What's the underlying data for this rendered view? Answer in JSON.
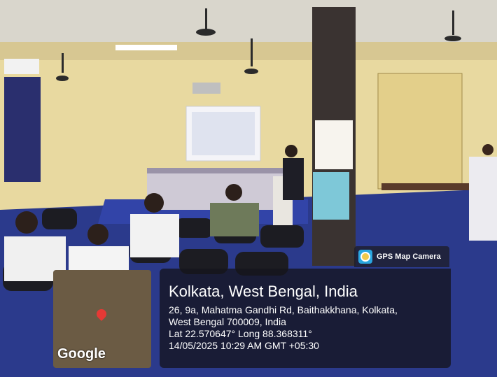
{
  "overlay": {
    "app_label": "GPS Map Camera",
    "location_title": "Kolkata, West Bengal, India",
    "address_line1": "26, 9a, Mahatma Gandhi Rd, Baithakkhana, Kolkata,",
    "address_line2": "West Bengal 700009, India",
    "coords": "Lat 22.570647° Long 88.368311°",
    "timestamp": "14/05/2025 10:29 AM GMT +05:30",
    "map_brand": "Google",
    "icons": [
      "camera-app-icon",
      "map-pin-icon"
    ]
  }
}
